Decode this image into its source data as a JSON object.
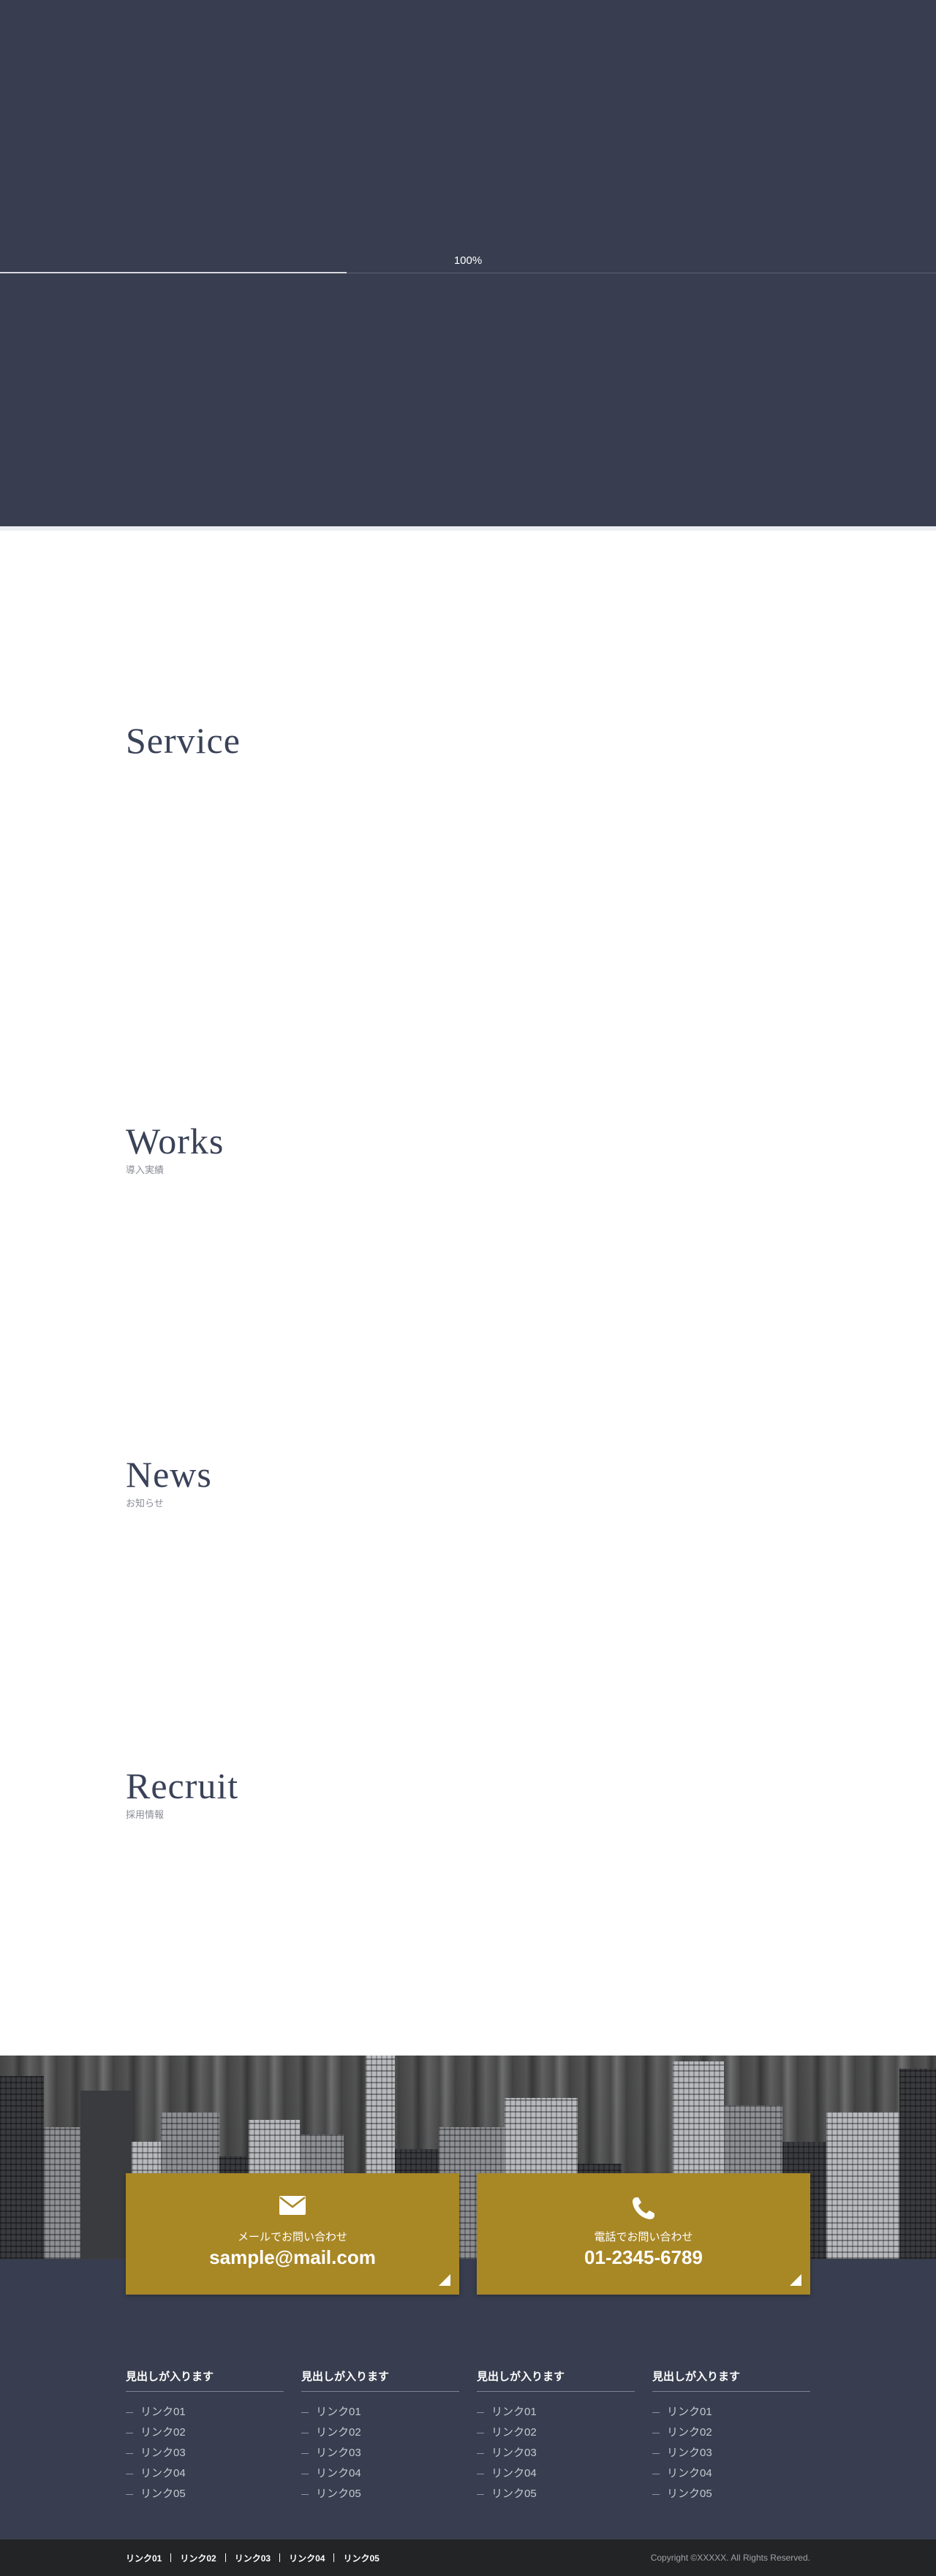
{
  "loader": {
    "percent_text": "100%",
    "progress": 0.37
  },
  "sections": {
    "service": {
      "title": "Service"
    },
    "works": {
      "title": "Works",
      "subtitle": "導入実績"
    },
    "news": {
      "title": "News",
      "subtitle": "お知らせ"
    },
    "recruit": {
      "title": "Recruit",
      "subtitle": "採用情報"
    }
  },
  "contact": {
    "mail": {
      "label": "メールでお問い合わせ",
      "value": "sample@mail.com",
      "icon": "envelope-icon"
    },
    "phone": {
      "label": "電話でお問い合わせ",
      "value": "01-2345-6789",
      "icon": "phone-icon"
    },
    "box_color": "#a88725"
  },
  "footer": {
    "columns": [
      {
        "heading": "見出しが入ります",
        "links": [
          "リンク01",
          "リンク02",
          "リンク03",
          "リンク04",
          "リンク05"
        ]
      },
      {
        "heading": "見出しが入ります",
        "links": [
          "リンク01",
          "リンク02",
          "リンク03",
          "リンク04",
          "リンク05"
        ]
      },
      {
        "heading": "見出しが入ります",
        "links": [
          "リンク01",
          "リンク02",
          "リンク03",
          "リンク04",
          "リンク05"
        ]
      },
      {
        "heading": "見出しが入ります",
        "links": [
          "リンク01",
          "リンク02",
          "リンク03",
          "リンク04",
          "リンク05"
        ]
      }
    ],
    "bottom_links": [
      "リンク01",
      "リンク02",
      "リンク03",
      "リンク04",
      "リンク05"
    ],
    "copyright": "Copyright ©XXXXX. All Rights Reserved."
  },
  "colors": {
    "navy": "#383e4f",
    "gold": "#a88725",
    "bottom_bar": "#232425"
  }
}
